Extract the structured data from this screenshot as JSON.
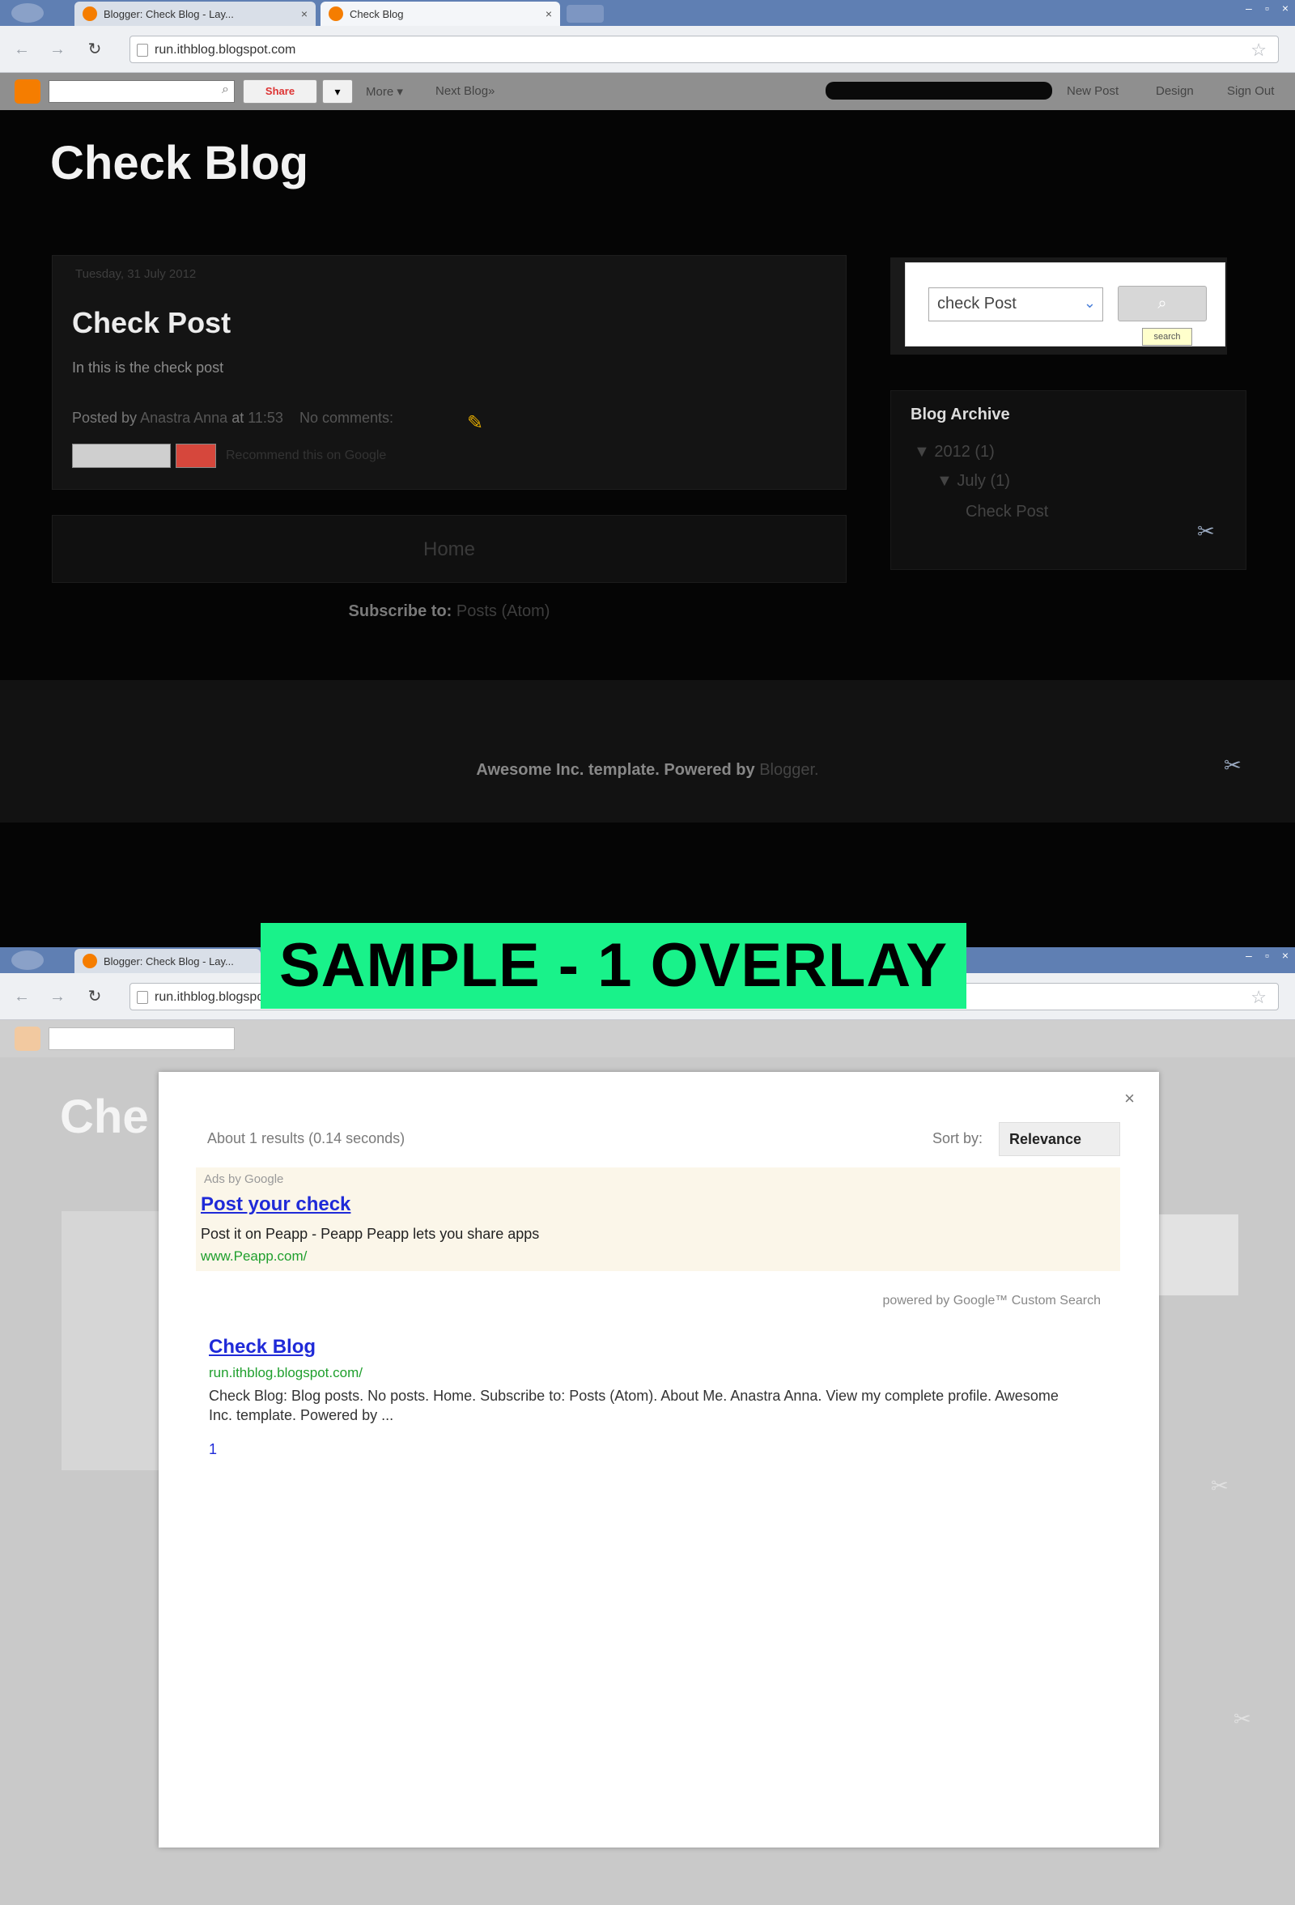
{
  "screenshot1": {
    "browser": {
      "tabs": [
        {
          "title": "Blogger: Check Blog - Lay..."
        },
        {
          "title": "Check Blog"
        }
      ],
      "url": "run.ithblog.blogspot.com"
    },
    "navbar": {
      "share_label": "Share",
      "more_label": "▾",
      "links": [
        "More ▾",
        "Next Blog»"
      ],
      "right_links": [
        "New Post",
        "Design",
        "Sign Out"
      ]
    },
    "blog_title": "Check Blog",
    "post": {
      "date": "Tuesday, 31 July 2012",
      "title": "Check Post",
      "body": "In this is the check post",
      "posted_by_label": "Posted by",
      "posted_by_author": "Anastra Anna",
      "posted_at_label": "at",
      "posted_time": "11:53",
      "comments": "No comments:",
      "recommend_text": "Recommend this on Google"
    },
    "home_label": "Home",
    "subscribe": {
      "label": "Subscribe to:",
      "link": "Posts (Atom)"
    },
    "search_widget": {
      "value": "check Post",
      "go_label": "⌕",
      "tip": "search"
    },
    "archive": {
      "title": "Blog Archive",
      "year": "▼  2012 (1)",
      "month": "▼  July (1)",
      "post": "Check Post"
    },
    "footer": {
      "label": "Awesome Inc. template.",
      "powered_label": "Powered by",
      "powered_link": "Blogger."
    }
  },
  "sample_label": "SAMPLE - 1 OVERLAY",
  "screenshot2": {
    "browser": {
      "tabs": [
        {
          "title": "Blogger: Check Blog - Lay..."
        }
      ],
      "url": "run.ithblog.blogspot.com"
    },
    "bg_title": "Che",
    "results": {
      "close": "×",
      "count": "About 1 results (0.14 seconds)",
      "sort_label": "Sort by:",
      "sort_value": "Relevance",
      "ad": {
        "by": "Ads by Google",
        "title": "Post your check",
        "desc": "Post it on Peapp - Peapp Peapp lets you share apps",
        "url": "www.Peapp.com/"
      },
      "ad_note": "powered by Google™ Custom Search",
      "result": {
        "title": "Check Blog",
        "url": "run.ithblog.blogspot.com/",
        "snippet": "Check Blog: Blog posts. No posts. Home. Subscribe to: Posts (Atom). About Me. Anastra Anna. View my complete profile. Awesome Inc. template. Powered by ..."
      },
      "page": "1"
    }
  }
}
